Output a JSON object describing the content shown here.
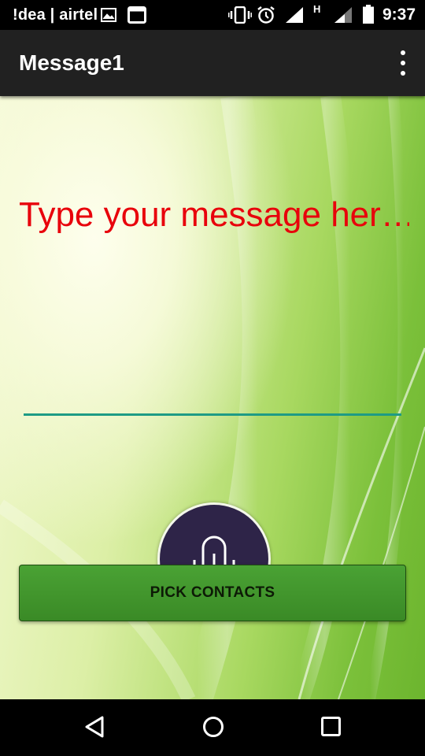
{
  "status_bar": {
    "carrier": "!dea | airtel",
    "time": "9:37",
    "network_type": "H",
    "icons": [
      "image-icon",
      "screen-icon",
      "vibrate-icon",
      "alarm-icon",
      "signal-icon",
      "signal-h-icon",
      "battery-icon"
    ]
  },
  "app_bar": {
    "title": "Message1",
    "menu_icon": "more-vert-icon"
  },
  "message": {
    "text": "Type your message her…",
    "color": "#e8000b"
  },
  "colors": {
    "underline": "#1e9b85",
    "mic_button": "#2e2448",
    "pick_button": "#3f9a2c",
    "app_bar": "#212121"
  },
  "mic_button": {
    "icon": "microphone-icon"
  },
  "pick_contacts": {
    "label": "PICK CONTACTS"
  },
  "nav_bar": {
    "items": [
      "back-icon",
      "home-icon",
      "recents-icon"
    ]
  }
}
